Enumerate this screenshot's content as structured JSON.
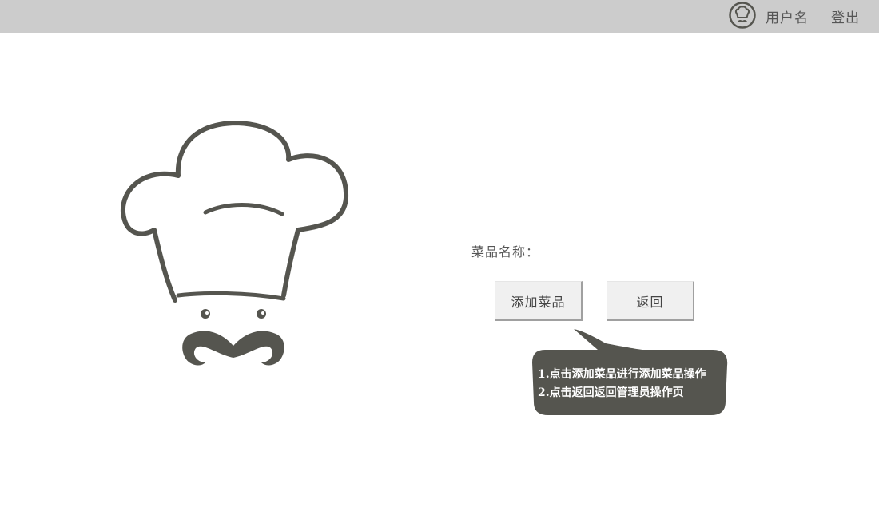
{
  "header": {
    "avatar_icon": "chef-hat-avatar-icon",
    "username": "用户名",
    "logout": "登出"
  },
  "logo_icon": "chef-hat-mustache-logo-icon",
  "form": {
    "dish_name_label": "菜品名称：",
    "dish_name_value": "",
    "dish_name_placeholder": ""
  },
  "buttons": {
    "add": "添加菜品",
    "back": "返回"
  },
  "tooltip": {
    "line1": "1.点击添加菜品进行添加菜品操作",
    "line2": "2.点击返回返回管理员操作页"
  },
  "colors": {
    "header_bg": "#cccccc",
    "logo_stroke": "#55554f",
    "tooltip_bg": "#55554f",
    "text": "#555555"
  }
}
